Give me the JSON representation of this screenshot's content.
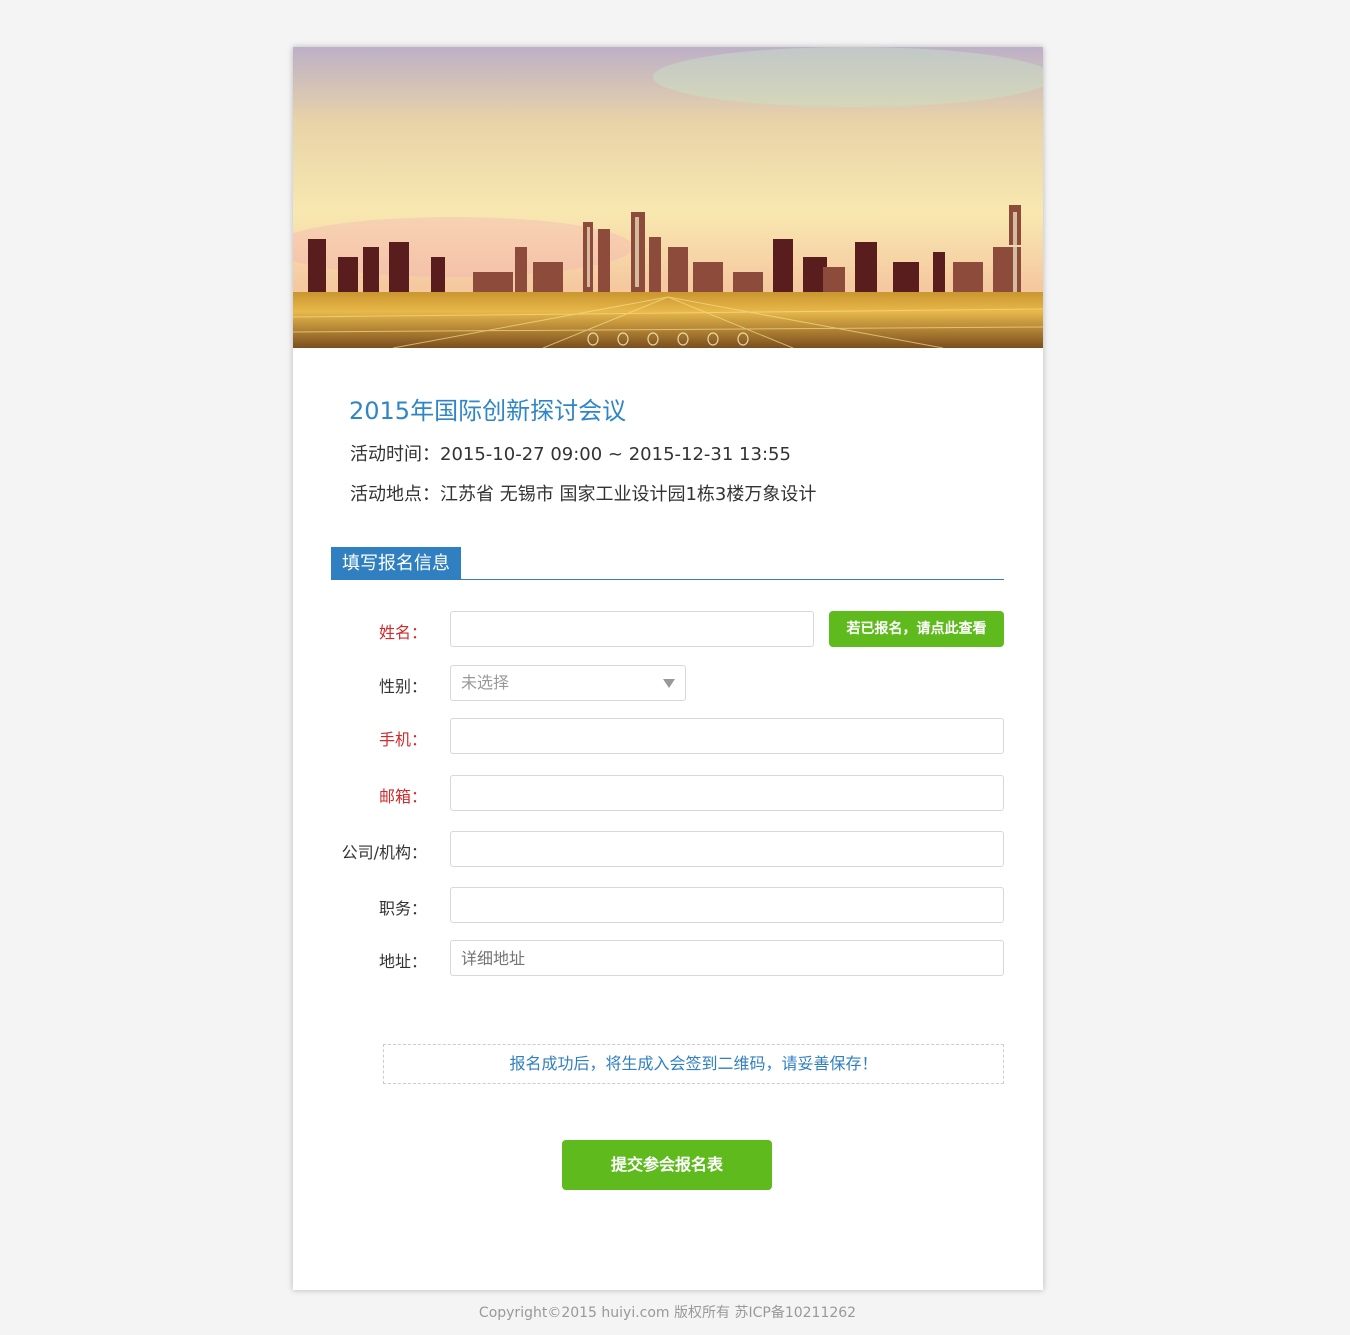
{
  "event": {
    "title": "2015年国际创新探讨会议",
    "time_line": "活动时间：2015-10-27 09:00 ~ 2015-12-31 13:55",
    "place_line": "活动地点：江苏省 无锡市 国家工业设计园1栋3楼万象设计"
  },
  "form": {
    "section_title": "填写报名信息",
    "fields": {
      "name": {
        "label": "姓名：",
        "required": true,
        "value": ""
      },
      "gender": {
        "label": "性别：",
        "required": false,
        "selected": "未选择"
      },
      "phone": {
        "label": "手机：",
        "required": true,
        "value": ""
      },
      "email": {
        "label": "邮箱：",
        "required": true,
        "value": ""
      },
      "company": {
        "label": "公司/机构：",
        "required": false,
        "value": ""
      },
      "position": {
        "label": "职务：",
        "required": false,
        "value": ""
      },
      "address": {
        "label": "地址：",
        "required": false,
        "value": "",
        "placeholder": "详细地址"
      }
    },
    "check_registered_button": "若已报名，请点此查看",
    "notice": "报名成功后，将生成入会签到二维码，请妥善保存！",
    "submit_button": "提交参会报名表"
  },
  "footer": {
    "copyright": "Copyright©2015 huiyi.com 版权所有 苏ICP备10211262"
  },
  "colors": {
    "accent_blue": "#2f7fc1",
    "button_green": "#5fba1e",
    "required_red": "#d02b2b"
  }
}
